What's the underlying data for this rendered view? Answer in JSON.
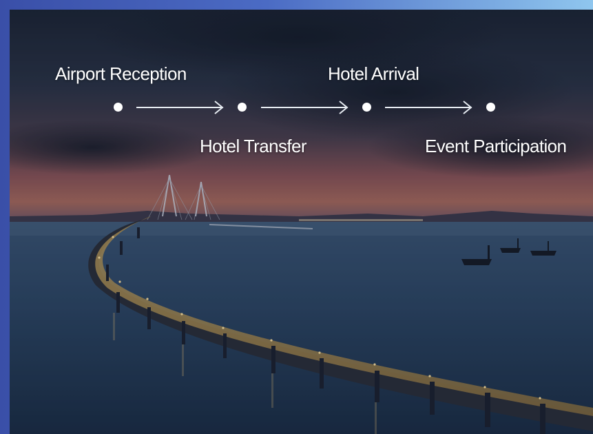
{
  "steps": [
    {
      "label": "Airport Reception"
    },
    {
      "label": "Hotel Transfer"
    },
    {
      "label": "Hotel Arrival"
    },
    {
      "label": "Event Participation"
    }
  ],
  "colors": {
    "frame_gradient_start": "#3a4fa8",
    "frame_gradient_end": "#8fc6ee",
    "dot": "#ffffff",
    "arrow": "#e8edf3",
    "label_text": "#ffffff"
  },
  "icons": {
    "step_marker": "dot-icon",
    "connector": "arrow-right-icon"
  }
}
